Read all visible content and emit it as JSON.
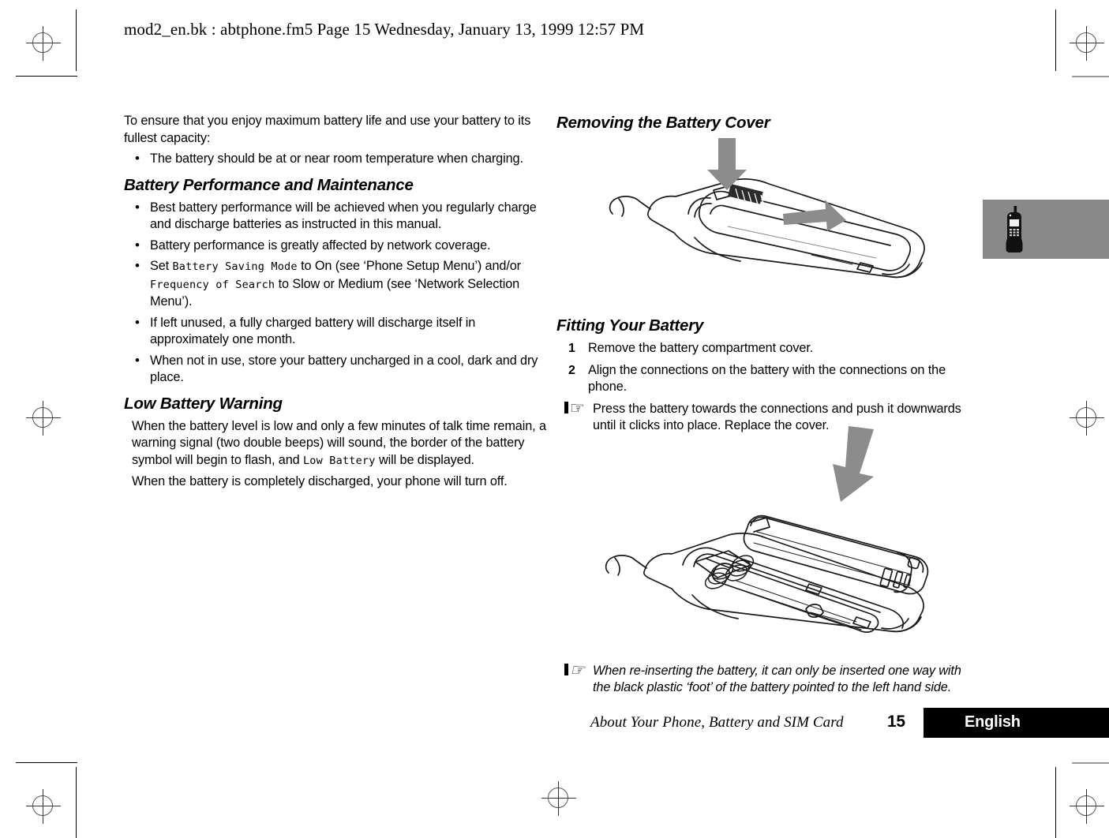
{
  "meta": {
    "running_head": "mod2_en.bk : abtphone.fm5  Page 15  Wednesday, January 13, 1999  12:57 PM"
  },
  "left_column": {
    "intro": "To ensure that you enjoy maximum battery life and use your battery to its fullest capacity:",
    "intro_bullets": [
      "The battery should be at or near room temperature when charging."
    ],
    "section_performance": {
      "heading": "Battery Performance and Maintenance",
      "bullets": [
        {
          "text": "Best battery performance will be achieved when you regularly charge and discharge batteries as instructed in this manual."
        },
        {
          "text": "Battery performance is greatly affected by network coverage."
        },
        {
          "rich": true,
          "part1": "Set ",
          "lcd1": "Battery Saving Mode",
          "part2": " to On (see ‘Phone Setup Menu’) and/or ",
          "lcd2": "Frequency of Search",
          "part3": " to Slow or Medium (see ‘Network Selection Menu’)."
        },
        {
          "text": "If left unused, a fully charged battery will discharge itself in approximately one month."
        },
        {
          "text": "When not in use, store your battery uncharged in a cool, dark and dry place."
        }
      ]
    },
    "section_low_battery": {
      "heading": "Low Battery Warning",
      "para1_part1": "When the battery level is low and only a few minutes of talk time remain, a warning signal (two double beeps) will sound, the border of the battery symbol will begin to flash, and ",
      "para1_lcd": "Low Battery",
      "para1_part2": " will be displayed.",
      "para2": "When the battery is completely discharged, your phone will turn off."
    }
  },
  "right_column": {
    "section_removing": {
      "heading": "Removing the Battery Cover",
      "figure_name": "phone-back-cover-removal-illustration"
    },
    "section_fitting": {
      "heading": "Fitting Your Battery",
      "steps": [
        {
          "num": "1",
          "text": "Remove the battery compartment cover."
        },
        {
          "num": "2",
          "text": "Align the connections on the battery with the connections on the phone."
        }
      ],
      "note1": "Press the battery towards the connections and push it downwards until it clicks into place. Replace the cover.",
      "figure_name": "phone-battery-insertion-illustration",
      "note2": "When re-inserting the battery, it can only be inserted one way with the black plastic ‘foot’ of the battery pointed to the left hand side."
    }
  },
  "thumb_tab": {
    "icon": "mobile-phone-icon",
    "color": "#898989"
  },
  "footer": {
    "title": "About Your Phone, Battery and SIM Card",
    "page_number": "15",
    "language": "English",
    "bar_color": "#000000"
  },
  "icons": {
    "pointing_hand": "☞",
    "bullet": "•"
  }
}
